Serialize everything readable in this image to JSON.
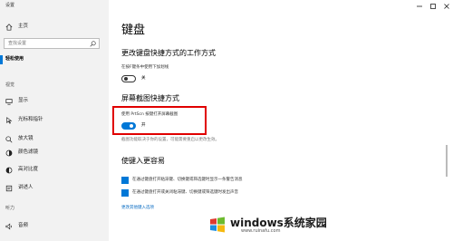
{
  "window": {
    "title": "设置"
  },
  "sidebar": {
    "home": "主页",
    "search_placeholder": "查找设置",
    "category": "轻松使用",
    "vision_header": "视觉",
    "items": [
      "显示",
      "光标和指针",
      "放大镜",
      "颜色滤镜",
      "高对比度",
      "讲述人"
    ],
    "hearing_header": "听力",
    "audio": "音频"
  },
  "main": {
    "title": "键盘",
    "section1": {
      "heading": "更改键盘快捷方式的工作方式",
      "desc": "在按F键条中使用下加划线",
      "toggle_state": "关",
      "toggle_on": false
    },
    "section2": {
      "heading": "屏幕截图快捷方式",
      "desc": "使用 PrtScn 按键打开屏幕截图",
      "toggle_state": "开",
      "toggle_on": true,
      "note": "截图功能取决于你的设置，可能需要重启以更改生效。"
    },
    "section3": {
      "heading": "使键入更容易",
      "check1": "在通过键盘打开粘滞键、切换键或筛选键时显示一条警告消息",
      "check2": "在通过键盘打开或关闭粘滞键、切换键或筛选键时发出声音",
      "link": "更改其他键入选项"
    }
  },
  "watermark": {
    "brand": "windows系统家园",
    "url": "www.ruinafu.com"
  },
  "colors": {
    "accent": "#0078d7",
    "highlight": "#e00000"
  }
}
